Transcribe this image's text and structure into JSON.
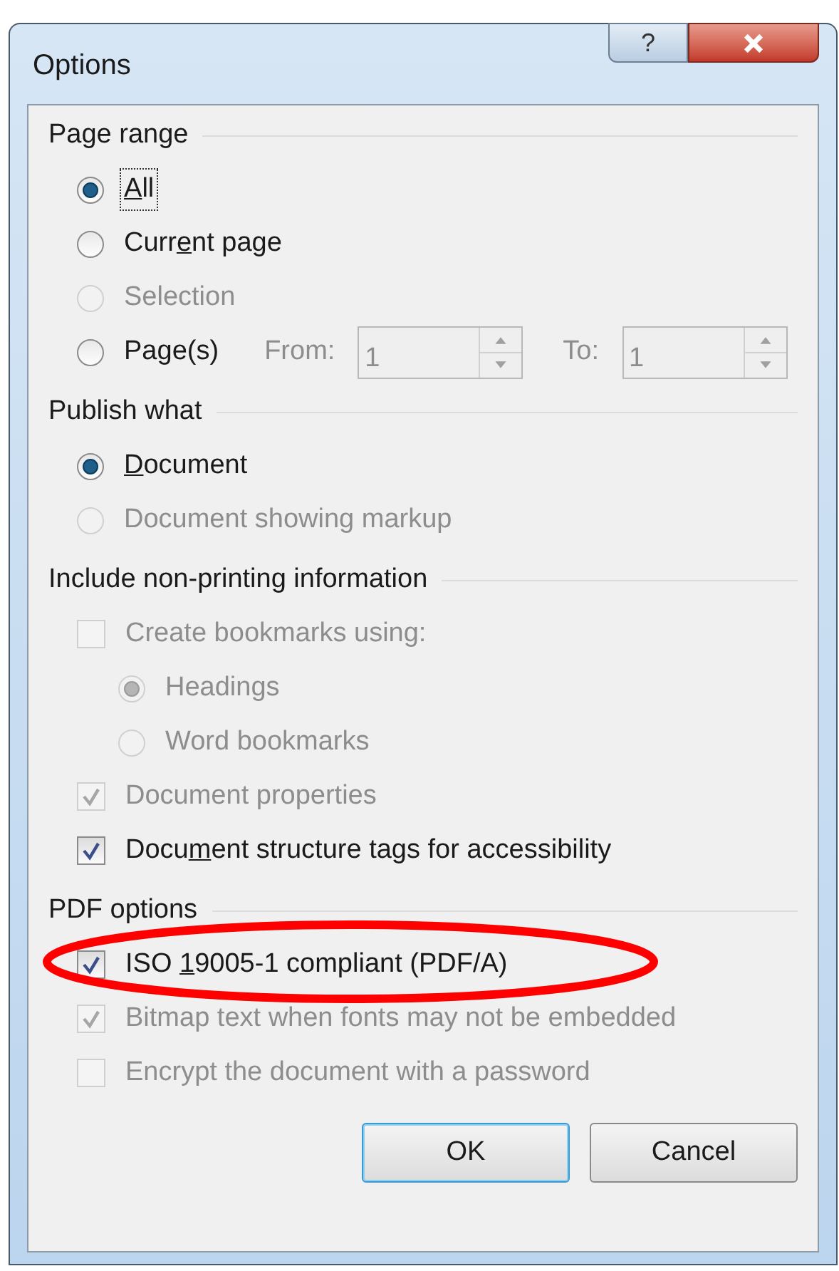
{
  "window": {
    "title": "Options"
  },
  "title_buttons": [
    {
      "kind": "help",
      "label": "?"
    },
    {
      "kind": "close"
    }
  ],
  "sections": [
    {
      "heading": "Page range",
      "items": [
        {
          "kind": "radio",
          "label": {
            "key": "A",
            "after": "ll"
          },
          "selected": true,
          "disabled": false,
          "focused": true
        },
        {
          "kind": "radio",
          "label": {
            "before": "Curr",
            "key": "e",
            "after": "nt page"
          },
          "selected": false,
          "disabled": false,
          "focused": false
        },
        {
          "kind": "radio",
          "label": {
            "before": "Selection"
          },
          "selected": false,
          "disabled": true,
          "focused": false
        },
        {
          "kind": "radio",
          "label": {
            "before": "Pa",
            "key": "g",
            "after": "e(s)"
          },
          "selected": false,
          "disabled": false,
          "focused": false,
          "fields": [
            {
              "label": "From:",
              "value": "1",
              "disabled": true
            },
            {
              "label": "To:",
              "value": "1",
              "disabled": true
            }
          ]
        }
      ]
    },
    {
      "heading": "Publish what",
      "items": [
        {
          "kind": "radio",
          "label": {
            "key": "D",
            "after": "ocument"
          },
          "selected": true,
          "disabled": false,
          "focused": false
        },
        {
          "kind": "radio",
          "label": {
            "before": "Document showing markup"
          },
          "selected": false,
          "disabled": true,
          "focused": false
        }
      ]
    },
    {
      "heading": "Include non-printing information",
      "items": [
        {
          "kind": "checkbox",
          "label": {
            "before": "Create bookmarks using:"
          },
          "checked": false,
          "disabled": true,
          "children": [
            {
              "kind": "radio",
              "label": {
                "before": "Headings"
              },
              "selected": true,
              "disabled": true,
              "focused": false
            },
            {
              "kind": "radio",
              "label": {
                "before": "Word bookmarks"
              },
              "selected": false,
              "disabled": true,
              "focused": false
            }
          ]
        },
        {
          "kind": "checkbox",
          "label": {
            "before": "Document properties"
          },
          "checked": true,
          "disabled": true
        },
        {
          "kind": "checkbox",
          "label": {
            "before": "Docu",
            "key": "m",
            "after": "ent structure tags for accessibility"
          },
          "checked": true,
          "disabled": false
        }
      ]
    },
    {
      "heading": "PDF options",
      "items": [
        {
          "kind": "checkbox",
          "label": {
            "before": "ISO ",
            "key": "1",
            "after": "9005-1 compliant (PDF/A)"
          },
          "checked": true,
          "disabled": false,
          "circled": true
        },
        {
          "kind": "checkbox",
          "label": {
            "before": "Bitmap text when fonts may not be embedded"
          },
          "checked": true,
          "disabled": true
        },
        {
          "kind": "checkbox",
          "label": {
            "before": "Encrypt the document with a password"
          },
          "checked": false,
          "disabled": true
        }
      ]
    }
  ],
  "buttons": [
    {
      "label": "OK",
      "default": true
    },
    {
      "label": "Cancel",
      "default": false
    }
  ]
}
